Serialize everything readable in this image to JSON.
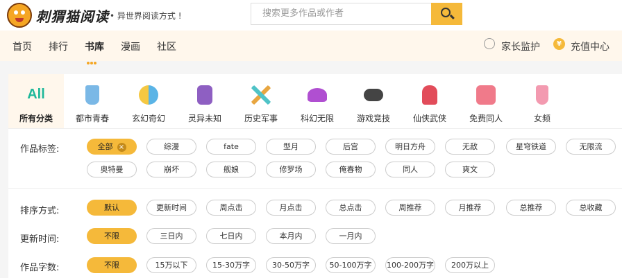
{
  "header": {
    "brand": "刺猬猫阅读",
    "slogan": "• 异世界阅读方式 !",
    "search_placeholder": "搜索更多作品或作者"
  },
  "nav": {
    "items": [
      "首页",
      "排行",
      "书库",
      "漫画",
      "社区"
    ],
    "active_index": 2,
    "parent_control": "家长监护",
    "recharge": "充值中心",
    "coin_icon_text": "¥"
  },
  "categories": [
    {
      "label": "所有分类",
      "icon": "All",
      "color": "#1fb89a",
      "active": true
    },
    {
      "label": "都市青春",
      "icon": "cup-icon",
      "color": "#7ab8e6"
    },
    {
      "label": "玄幻奇幻",
      "icon": "yinyang-icon",
      "color": "#f5c842"
    },
    {
      "label": "灵异未知",
      "icon": "card-icon",
      "color": "#8e5fc2"
    },
    {
      "label": "历史军事",
      "icon": "swords-icon",
      "color": "#4fc3c7"
    },
    {
      "label": "科幻无限",
      "icon": "ufo-icon",
      "color": "#b04fd1"
    },
    {
      "label": "游戏竞技",
      "icon": "gamepad-icon",
      "color": "#444444"
    },
    {
      "label": "仙侠武侠",
      "icon": "glove-icon",
      "color": "#e24c5a"
    },
    {
      "label": "免费同人",
      "icon": "pig-icon",
      "color": "#f07a8a"
    },
    {
      "label": "女频",
      "icon": "dress-icon",
      "color": "#f39ab0"
    }
  ],
  "filters": {
    "tags": {
      "label": "作品标签:",
      "row1": [
        "全部",
        "综漫",
        "fate",
        "型月",
        "后宫",
        "明日方舟",
        "无敌",
        "星穹铁道",
        "无限流"
      ],
      "row2": [
        "奥特曼",
        "崩坏",
        "舰娘",
        "修罗场",
        "俺春物",
        "同人",
        "爽文"
      ],
      "clear_icon": "×"
    },
    "sort": {
      "label": "排序方式:",
      "options": [
        "默认",
        "更新时间",
        "周点击",
        "月点击",
        "总点击",
        "周推荐",
        "月推荐",
        "总推荐",
        "总收藏"
      ]
    },
    "update": {
      "label": "更新时间:",
      "options": [
        "不限",
        "三日内",
        "七日内",
        "本月内",
        "一月内"
      ]
    },
    "words": {
      "label": "作品字数:",
      "options": [
        "不限",
        "15万以下",
        "15-30万字",
        "30-50万字",
        "50-100万字",
        "100-200万字",
        "200万以上"
      ]
    }
  }
}
